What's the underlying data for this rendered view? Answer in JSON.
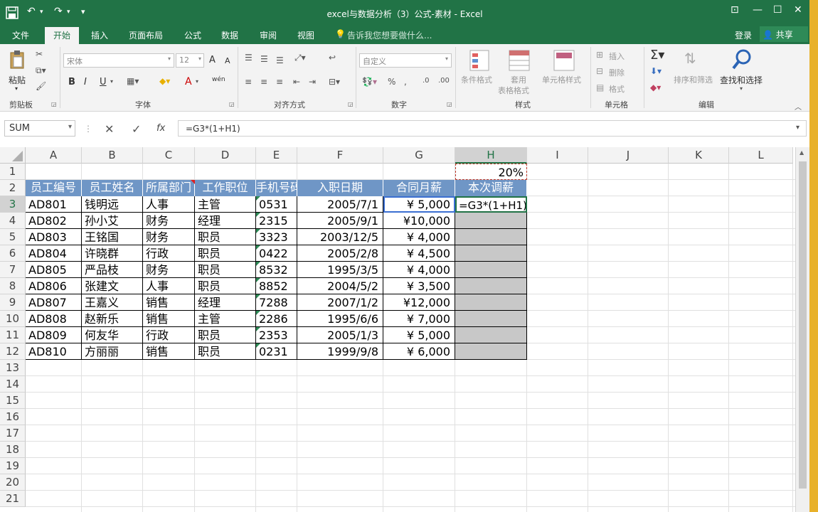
{
  "window": {
    "title": "excel与数据分析（3）公式-素材 - Excel",
    "qa_undo": "↶",
    "qa_redo": "↷",
    "qa_more": "▾",
    "ctrl_ribbon": "⊡",
    "ctrl_min": "—",
    "ctrl_max": "☐",
    "ctrl_close": "✕"
  },
  "tabs": {
    "file": "文件",
    "home": "开始",
    "insert": "插入",
    "page_layout": "页面布局",
    "formulas": "公式",
    "data": "数据",
    "review": "审阅",
    "view": "视图",
    "tell_me": "告诉我您想要做什么...",
    "login": "登录",
    "share": "共享"
  },
  "ribbon": {
    "clipboard": {
      "label": "剪贴板",
      "paste": "粘贴"
    },
    "font": {
      "label": "字体",
      "font_name": "宋体",
      "font_size": "12",
      "bold": "B",
      "italic": "I",
      "underline": "U",
      "grow": "A",
      "shrink": "A",
      "wen": "wén"
    },
    "alignment": {
      "label": "对齐方式"
    },
    "number": {
      "label": "数字",
      "format": "自定义"
    },
    "styles": {
      "label": "样式",
      "conditional": "条件格式",
      "table1": "套用",
      "table2": "表格格式",
      "cell_styles": "单元格样式"
    },
    "cells": {
      "label": "单元格",
      "insert": "插入",
      "delete": "删除",
      "format": "格式"
    },
    "editing": {
      "label": "编辑",
      "sort": "排序和筛选",
      "find": "查找和选择"
    }
  },
  "formula_bar": {
    "name_box": "SUM",
    "fx": "fx",
    "formula": "=G3*(1+H1)"
  },
  "sheet": {
    "columns": [
      "A",
      "B",
      "C",
      "D",
      "E",
      "F",
      "G",
      "H",
      "I",
      "J",
      "K",
      "L"
    ],
    "rows": [
      "1",
      "2",
      "3",
      "4",
      "5",
      "6",
      "7",
      "8",
      "9",
      "10",
      "11",
      "12",
      "13",
      "14",
      "15",
      "16",
      "17",
      "18",
      "19",
      "20",
      "21"
    ],
    "h1": "20%",
    "headers": [
      "员工编号",
      "员工姓名",
      "所属部门",
      "工作职位",
      "手机号码",
      "入职日期",
      "合同月薪",
      "本次调薪"
    ],
    "data": [
      [
        "AD801",
        "钱明远",
        "人事",
        "主管",
        "0531",
        "2005/7/1",
        "¥  5,000"
      ],
      [
        "AD802",
        "孙小艾",
        "财务",
        "经理",
        "2315",
        "2005/9/1",
        "¥10,000"
      ],
      [
        "AD803",
        "王铭国",
        "财务",
        "职员",
        "3323",
        "2003/12/5",
        "¥  4,000"
      ],
      [
        "AD804",
        "许晓群",
        "行政",
        "职员",
        "0422",
        "2005/2/8",
        "¥  4,500"
      ],
      [
        "AD805",
        "严品枝",
        "财务",
        "职员",
        "8532",
        "1995/3/5",
        "¥  4,000"
      ],
      [
        "AD806",
        "张建文",
        "人事",
        "职员",
        "8852",
        "2004/5/2",
        "¥  3,500"
      ],
      [
        "AD807",
        "王嘉义",
        "销售",
        "经理",
        "7288",
        "2007/1/2",
        "¥12,000"
      ],
      [
        "AD808",
        "赵新乐",
        "销售",
        "主管",
        "2286",
        "1995/6/6",
        "¥  7,000"
      ],
      [
        "AD809",
        "何友华",
        "行政",
        "职员",
        "2353",
        "2005/1/3",
        "¥  5,000"
      ],
      [
        "AD810",
        "方丽丽",
        "销售",
        "职员",
        "0231",
        "1999/9/8",
        "¥  6,000"
      ]
    ],
    "editing_cell": "=G3*(1+H1)"
  },
  "colors": {
    "excel_green": "#217346",
    "header_fill": "#6f96c6",
    "selection_fill": "#c8c8c8"
  }
}
